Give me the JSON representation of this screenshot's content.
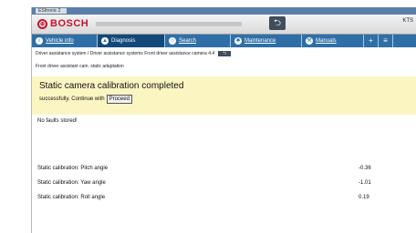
{
  "titlebar": {
    "tab_label": "ESItronic 2"
  },
  "header": {
    "brand": "BOSCH",
    "device": "KTS",
    "back_icon": "back-arrow-icon"
  },
  "nav": {
    "items": [
      {
        "label": "Vehicle info",
        "icon": "info-icon",
        "width": 72
      },
      {
        "label": "Diagnosis",
        "icon": "car-icon",
        "width": 74,
        "active": true
      },
      {
        "label": "Search",
        "icon": "search-icon",
        "width": 72
      },
      {
        "label": "Maintenance",
        "icon": "maintenance-icon",
        "width": 78
      },
      {
        "label": "Manuals",
        "icon": "wrench-icon",
        "width": 68
      }
    ],
    "extra": [
      "+",
      "≡"
    ]
  },
  "breadcrumb": "Driver assistance system / Driver assistance systems Front driver assistance camera 4.4",
  "subpath": "Front driver assistant cam. static adaptation",
  "banner": {
    "title": "Static camera calibration completed",
    "message": "successfully. Continue with",
    "proceed_label": "Proceed"
  },
  "status": "No faults stored!",
  "calibration": [
    {
      "label": "Static calibration: Pitch angle",
      "value": "-0.36"
    },
    {
      "label": "Static calibration: Yaw angle",
      "value": "-1.01"
    },
    {
      "label": "Static calibration: Roll angle",
      "value": "0.19"
    }
  ],
  "colors": {
    "brand": "#c8102e",
    "nav": "#2e6fa8",
    "banner": "#fbf5c2"
  }
}
